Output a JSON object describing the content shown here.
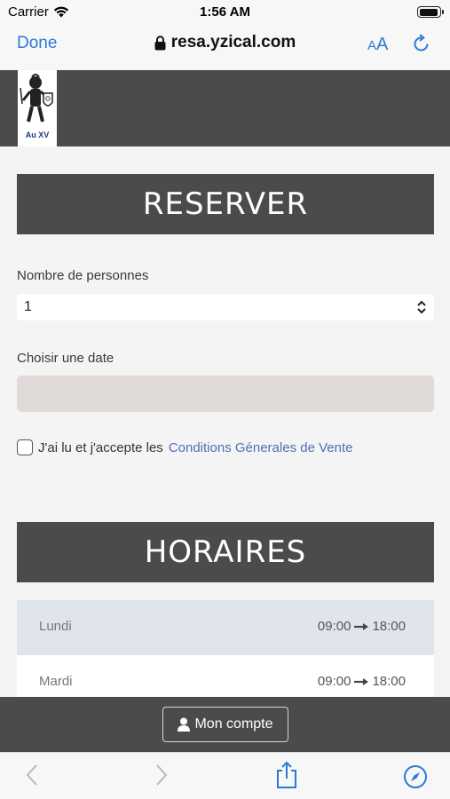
{
  "status_bar": {
    "carrier": "Carrier",
    "time": "1:56 AM"
  },
  "browser": {
    "done_label": "Done",
    "url": "resa.yzical.com",
    "text_size_small": "A",
    "text_size_large": "A"
  },
  "site": {
    "logo_text": "Au XV"
  },
  "reserve": {
    "title": "RESERVER",
    "people_label": "Nombre de personnes",
    "people_value": "1",
    "date_label": "Choisir une date",
    "date_value": "",
    "cgv_prefix": "J'ai lu et j'accepte les",
    "cgv_link": "Conditions Génerales de Vente"
  },
  "hours": {
    "title": "HORAIRES",
    "rows": [
      {
        "day": "Lundi",
        "open": "09:00",
        "close": "18:00"
      },
      {
        "day": "Mardi",
        "open": "09:00",
        "close": "18:00"
      }
    ]
  },
  "account": {
    "button_label": "Mon compte"
  },
  "colors": {
    "dark_band": "#4b4b4b",
    "link_blue": "#4f6fb8",
    "ios_blue": "#2d7ad6",
    "date_field": "#e0dbd9"
  }
}
